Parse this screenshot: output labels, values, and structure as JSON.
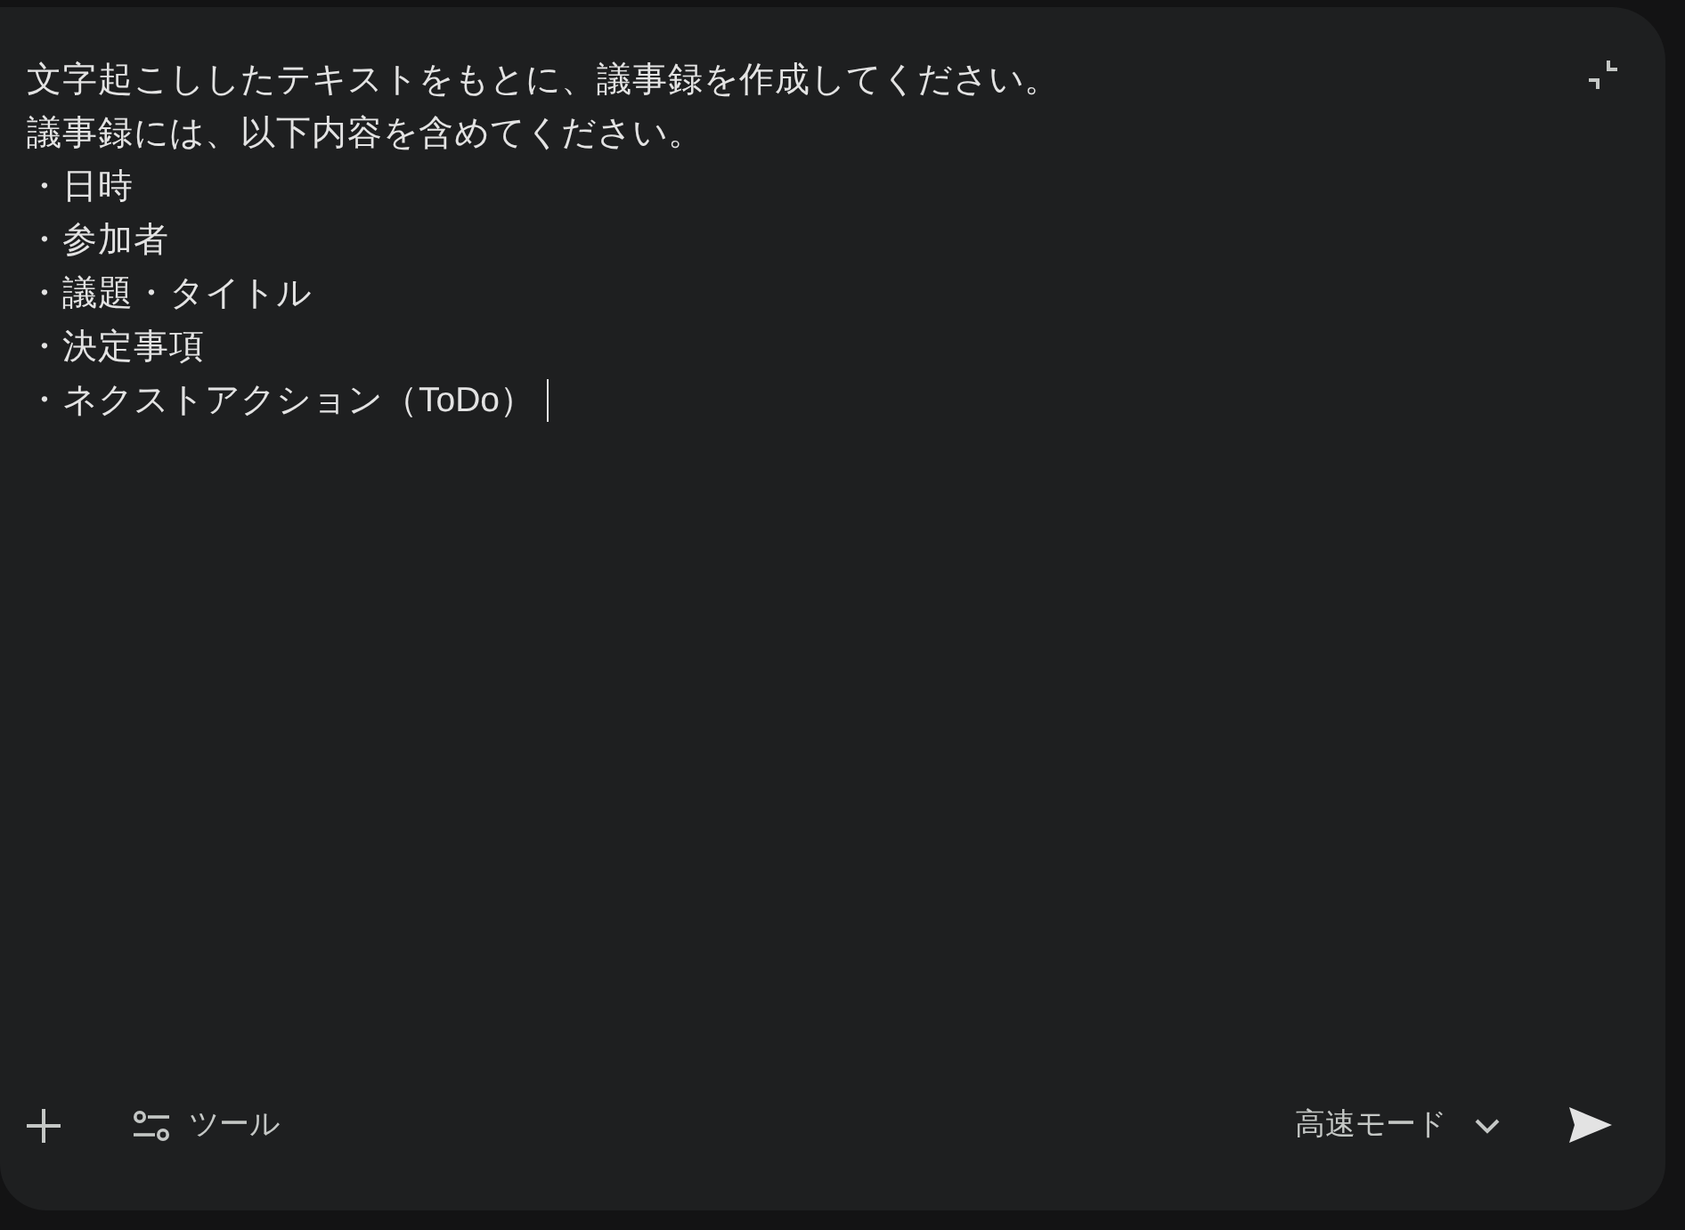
{
  "prompt": {
    "lines": [
      "文字起こししたテキストをもとに、議事録を作成してください。",
      "議事録には、以下内容を含めてください。",
      "・日時",
      "・参加者",
      "・議題・タイトル",
      "・決定事項",
      "・ネクストアクション（ToDo）"
    ],
    "focused": true
  },
  "toolbar": {
    "tools_label": "ツール",
    "mode_label": "高速モード"
  }
}
